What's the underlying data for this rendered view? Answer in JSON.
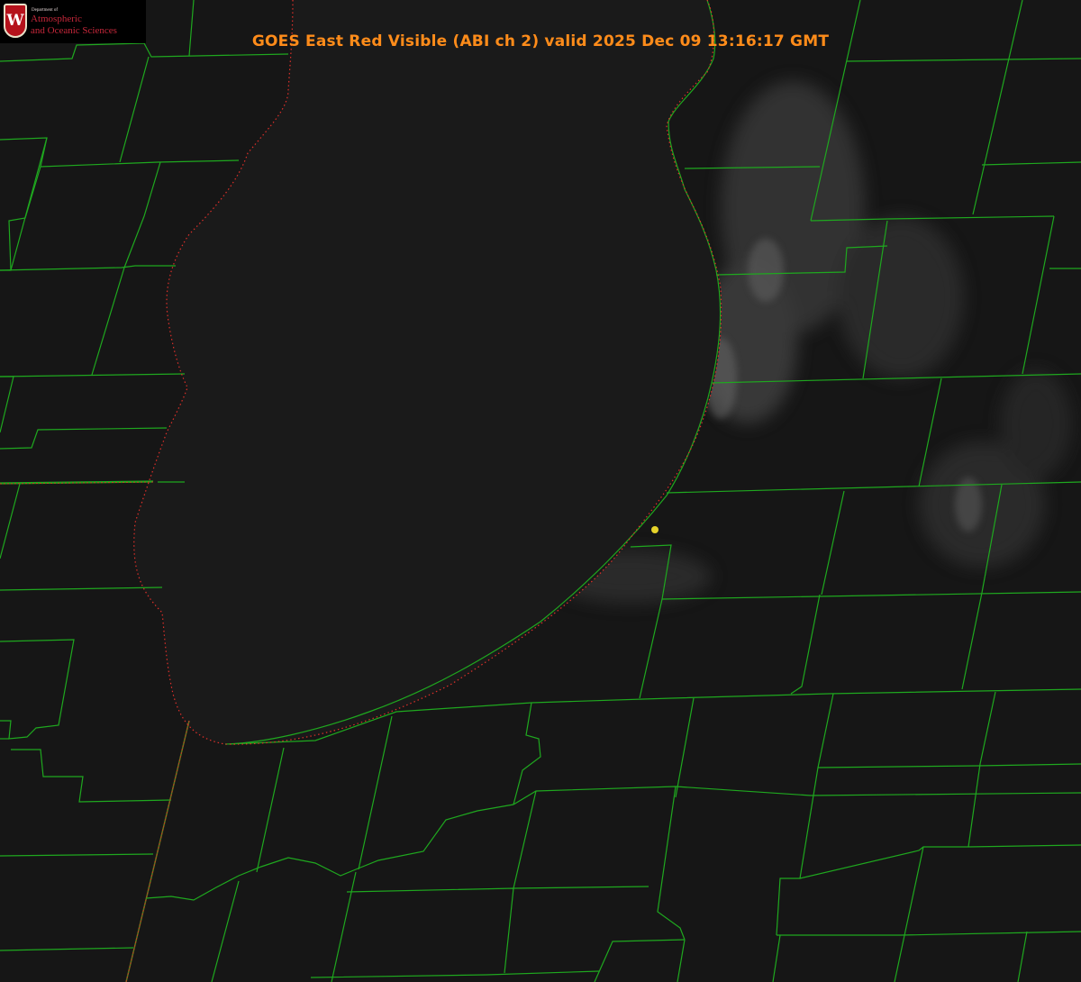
{
  "title": "GOES East Red Visible (ABI ch 2) valid 2025 Dec 09 13:16:17 GMT",
  "logo": {
    "department": "Department of",
    "line1": "Atmospheric",
    "line2": "and Oceanic Sciences",
    "crest_letter": "W"
  },
  "colors": {
    "background": "#151515",
    "lake": "#191919",
    "county_lines": "#1fa81f",
    "shoreline_dots": "#e0302a",
    "title": "#ff8c1a",
    "station_marker": "#e6d32a",
    "logo_red": "#c5273a"
  },
  "layers": [
    "satellite-visible",
    "county-boundaries",
    "shoreline",
    "station-marker"
  ]
}
